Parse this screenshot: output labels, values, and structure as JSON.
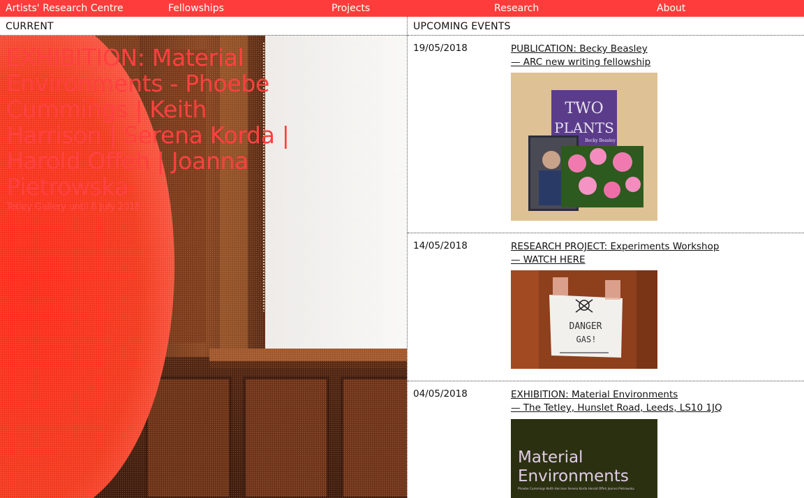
{
  "nav": {
    "home": "Artists' Research Centre",
    "fellowships": "Fellowships",
    "projects": "Projects",
    "research": "Research",
    "about": "About"
  },
  "current": {
    "heading": "CURRENT",
    "title": "EXHIBITION: Material Environments - Phoebe Cummings | Keith Harrison | Serena Korda | Harold Offeh | Joanna Pietrowska",
    "subtitle": "Tetley Gallery until 8 July 2018"
  },
  "upcoming": {
    "heading": "UPCOMING EVENTS",
    "events": [
      {
        "date": "19/05/2018",
        "title_line1": "PUBLICATION: Becky Beasley",
        "title_line2": "— ARC new writing fellowship",
        "image": {
          "book_title_line1": "TWO",
          "book_title_line2": "PLANTS",
          "book_author": "Becky Beasley"
        }
      },
      {
        "date": "14/05/2018",
        "title_line1": "RESEARCH PROJECT: Experiments Workshop",
        "title_line2": "— WATCH HERE",
        "image": {
          "sign_line1": "DANGER",
          "sign_line2": "GAS!"
        }
      },
      {
        "date": "04/05/2018",
        "title_line1": "EXHIBITION: Material Environments",
        "title_line2": "— The Tetley, Hunslet Road, Leeds, LS10 1JQ",
        "image": {
          "poster_line1": "Material",
          "poster_line2": "Environments",
          "poster_names": "Phoebe Cummings   Keith Harrison   Serena Korda   Harold Offeh   Joanna Pietrowska"
        }
      }
    ]
  },
  "colors": {
    "brand_red": "#ff3c3c",
    "title_red": "#ff4040",
    "divider": "#444444"
  }
}
